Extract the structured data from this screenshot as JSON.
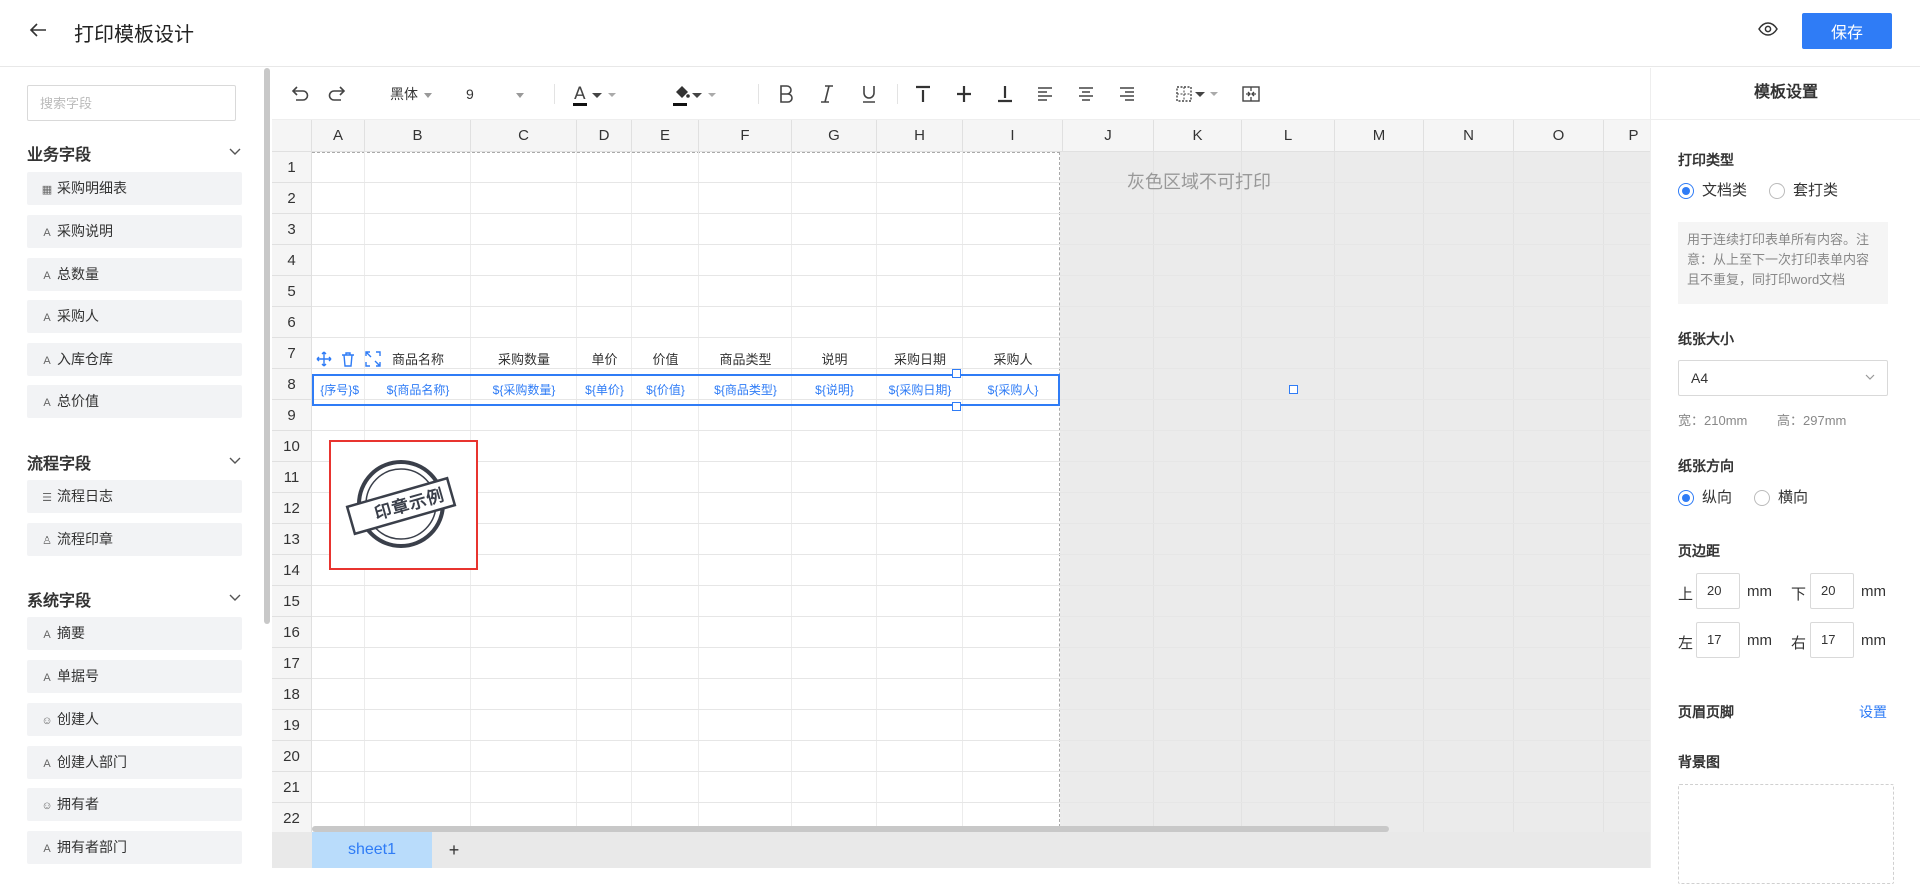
{
  "header": {
    "back_icon": "arrow-left-icon",
    "title": "打印模板设计",
    "save_label": "保存"
  },
  "left": {
    "search_placeholder": "搜索字段",
    "groups": [
      {
        "title": "业务字段",
        "items": [
          {
            "label": "采购明细表",
            "icon": "table-icon"
          },
          {
            "label": "采购说明",
            "icon": "text-icon"
          },
          {
            "label": "总数量",
            "icon": "text-icon"
          },
          {
            "label": "采购人",
            "icon": "text-icon"
          },
          {
            "label": "入库仓库",
            "icon": "text-icon"
          },
          {
            "label": "总价值",
            "icon": "text-icon"
          }
        ]
      },
      {
        "title": "流程字段",
        "items": [
          {
            "label": "流程日志",
            "icon": "list-icon"
          },
          {
            "label": "流程印章",
            "icon": "stamp-icon"
          }
        ]
      },
      {
        "title": "系统字段",
        "items": [
          {
            "label": "摘要",
            "icon": "text-icon"
          },
          {
            "label": "单据号",
            "icon": "text-icon"
          },
          {
            "label": "创建人",
            "icon": "user-icon"
          },
          {
            "label": "创建人部门",
            "icon": "text-icon"
          },
          {
            "label": "拥有者",
            "icon": "user-icon"
          },
          {
            "label": "拥有者部门",
            "icon": "text-icon"
          }
        ]
      }
    ]
  },
  "toolbar": {
    "font": "黑体",
    "size": "9"
  },
  "grid": {
    "columns": [
      "A",
      "B",
      "C",
      "D",
      "E",
      "F",
      "G",
      "H",
      "I",
      "J",
      "K",
      "L",
      "M",
      "N",
      "O",
      "P"
    ],
    "rows": [
      "1",
      "2",
      "3",
      "4",
      "5",
      "6",
      "7",
      "8",
      "9",
      "10",
      "11",
      "12",
      "13",
      "14",
      "15",
      "16",
      "17",
      "18",
      "19",
      "20",
      "21",
      "22"
    ],
    "gray_note": "灰色区域不可打印",
    "headers": [
      "商品名称",
      "采购数量",
      "单价",
      "价值",
      "商品类型",
      "说明",
      "采购日期",
      "采购人"
    ],
    "values": [
      "${序号}",
      "${商品名称}",
      "${采购数量}",
      "${单价}",
      "${价值}",
      "${商品类型}",
      "${说明}",
      "${采购日期}",
      "${采购人}"
    ],
    "stamp_text": "印章示例"
  },
  "tabs": {
    "sheet": "sheet1",
    "add": "+"
  },
  "right": {
    "title": "模板设置",
    "print_type_label": "打印类型",
    "print_type_options": [
      "文档类",
      "套打类"
    ],
    "print_type_hint": "用于连续打印表单所有内容。注意：从上至下一次打印表单内容且不重复，同打印word文档",
    "paper_size_label": "纸张大小",
    "paper_size": "A4",
    "width_text": "宽：210mm",
    "height_text": "高：297mm",
    "orientation_label": "纸张方向",
    "orientation_options": [
      "纵向",
      "横向"
    ],
    "margin_label": "页边距",
    "margins": {
      "top_label": "上",
      "top": "20",
      "bottom_label": "下",
      "bottom": "20",
      "left_label": "左",
      "left": "17",
      "right_label": "右",
      "right": "17",
      "unit": "mm"
    },
    "header_footer_label": "页眉页脚",
    "header_footer_link": "设置",
    "background_label": "背景图"
  },
  "colors": {
    "accent": "#2f7cf6",
    "stamp_border": "#e8342f"
  }
}
